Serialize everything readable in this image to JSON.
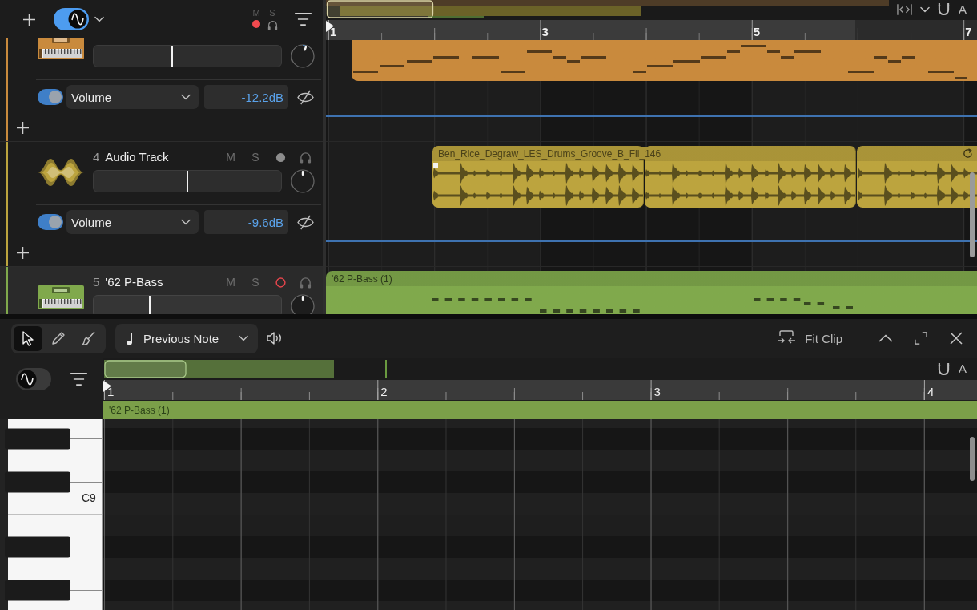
{
  "track_header": {
    "monitor_toggle": {
      "on": true
    },
    "mute_label": "M",
    "solo_label": "S",
    "record_enabled": true
  },
  "arrange": {
    "automation_label": "A",
    "ruler": [
      "1",
      "3",
      "5",
      "7"
    ]
  },
  "tracks": [
    {
      "kind": "instrument",
      "color": "#c98a3d",
      "selected": false,
      "volume": {
        "level": 0.42
      },
      "pan": {
        "level": 0.57
      },
      "automation": {
        "on": true,
        "parameter": "Volume",
        "value": "-12.2dB"
      },
      "region": {
        "kind": "midi"
      }
    },
    {
      "kind": "audio",
      "number": "4",
      "name": "Audio Track",
      "color": "#bca43e",
      "selected": false,
      "mute": {
        "label": "M",
        "on": false
      },
      "solo": {
        "label": "S",
        "on": false
      },
      "record_armed": false,
      "volume": {
        "level": 0.5
      },
      "pan": {
        "level": 0.5
      },
      "automation": {
        "on": true,
        "parameter": "Volume",
        "value": "-9.6dB"
      },
      "region": {
        "kind": "audio",
        "name": "Ben_Rice_Degraw_LES_Drums_Groove_B_Fil_146",
        "looped": true
      }
    },
    {
      "kind": "instrument",
      "number": "5",
      "name": "'62 P-Bass",
      "color": "#80a94c",
      "selected": true,
      "mute": {
        "label": "M",
        "on": false
      },
      "solo": {
        "label": "S",
        "on": false
      },
      "record_armed": true,
      "volume": {
        "level": 0.3
      },
      "pan": {
        "level": 0.5
      },
      "region": {
        "kind": "midi",
        "name": "'62 P-Bass (1)"
      }
    }
  ],
  "editor": {
    "tools": [
      {
        "kind": "pointer",
        "selected": true
      },
      {
        "kind": "pencil",
        "selected": false
      },
      {
        "kind": "brush",
        "selected": false
      }
    ],
    "note_mode": "Previous Note",
    "fit_button": "Fit Clip",
    "view_toggle": {
      "on": false
    },
    "automation_label": "A",
    "ruler": [
      "1",
      "2",
      "3",
      "4"
    ],
    "region_name": "'62 P-Bass (1)",
    "key_label": "C9"
  }
}
